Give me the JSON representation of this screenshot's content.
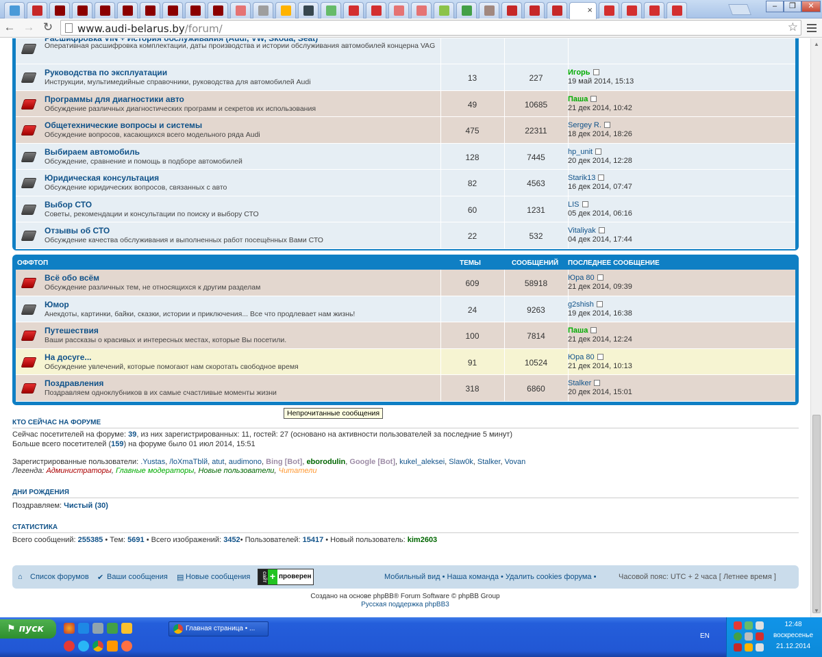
{
  "browser": {
    "url_host": "www.audi-belarus.by",
    "url_path": "/forum/",
    "tabs_count": 30,
    "active_tab_index": 25
  },
  "section1": {
    "rows": [
      {
        "title": "Расшифровка VIN + История обслуживания (Audi, VW, Skoda, Seat)",
        "desc": "Оперативная расшифровка комплектации, даты производства и истории обслуживания автомобилей концерна VAG",
        "topics": "",
        "posts": "",
        "last_user": "",
        "last_date": "",
        "state": "read",
        "user_style": "normal"
      },
      {
        "title": "Руководства по эксплуатации",
        "desc": "Инструкции, мультимедийные справочники, руководства для автомобилей Audi",
        "topics": "13",
        "posts": "227",
        "last_user": "Игорь",
        "last_date": "19 май 2014, 15:13",
        "state": "read",
        "user_style": "mod"
      },
      {
        "title": "Программы для диагностики авто",
        "desc": "Обсуждение различных диагностических программ и секретов их использования",
        "topics": "49",
        "posts": "10685",
        "last_user": "Паша",
        "last_date": "21 дек 2014, 10:42",
        "state": "unread",
        "user_style": "mod"
      },
      {
        "title": "Общетехнические вопросы и системы",
        "desc": "Обсуждение вопросов, касающихся всего модельного ряда Audi",
        "topics": "475",
        "posts": "22311",
        "last_user": "Sergey R.",
        "last_date": "18 дек 2014, 18:26",
        "state": "unread",
        "user_style": "normal"
      },
      {
        "title": "Выбираем автомобиль",
        "desc": "Обсуждение, сравнение и помощь в подборе автомобилей",
        "topics": "128",
        "posts": "7445",
        "last_user": "hp_unit",
        "last_date": "20 дек 2014, 12:28",
        "state": "read",
        "user_style": "normal"
      },
      {
        "title": "Юридическая консультация",
        "desc": "Обсуждение юридических вопросов, связанных с авто",
        "topics": "82",
        "posts": "4563",
        "last_user": "Starik13",
        "last_date": "16 дек 2014, 07:47",
        "state": "read",
        "user_style": "normal"
      },
      {
        "title": "Выбор СТО",
        "desc": "Советы, рекомендации и консультации по поиску и выбору СТО",
        "topics": "60",
        "posts": "1231",
        "last_user": "LIS",
        "last_date": "05 дек 2014, 06:16",
        "state": "read",
        "user_style": "normal"
      },
      {
        "title": "Отзывы об СТО",
        "desc": "Обсуждение качества обслуживания и выполненных работ посещённых Вами СТО",
        "topics": "22",
        "posts": "532",
        "last_user": "Vitaliyak",
        "last_date": "04 дек 2014, 17:44",
        "state": "read",
        "user_style": "normal"
      }
    ]
  },
  "section2": {
    "header": {
      "name": "ОФФТОП",
      "topics": "ТЕМЫ",
      "posts": "СООБЩЕНИЙ",
      "last": "ПОСЛЕДНЕЕ СООБЩЕНИЕ"
    },
    "rows": [
      {
        "title": "Всё обо всём",
        "desc": "Обсуждение различных тем, не относящихся к другим разделам",
        "topics": "609",
        "posts": "58918",
        "last_user": "Юра 80",
        "last_date": "21 дек 2014, 09:39",
        "state": "unread",
        "user_style": "normal"
      },
      {
        "title": "Юмор",
        "desc": "Анекдоты, картинки, байки, сказки, истории и приключения... Все что продлевает нам жизнь!",
        "topics": "24",
        "posts": "9263",
        "last_user": "g2shish",
        "last_date": "19 дек 2014, 16:38",
        "state": "read",
        "user_style": "normal"
      },
      {
        "title": "Путешествия",
        "desc": "Ваши рассказы о красивых и интересных местах, которые Вы посетили.",
        "topics": "100",
        "posts": "7814",
        "last_user": "Паша",
        "last_date": "21 дек 2014, 12:24",
        "state": "unread",
        "user_style": "mod"
      },
      {
        "title": "На досуге...",
        "desc": "Обсуждение увлечений, которые помогают нам скоротать свободное время",
        "topics": "91",
        "posts": "10524",
        "last_user": "Юра 80",
        "last_date": "21 дек 2014, 10:13",
        "state": "unread",
        "user_style": "normal"
      },
      {
        "title": "Поздравления",
        "desc": "Поздравляем одноклубников в их самые счастливые моменты жизни",
        "topics": "318",
        "posts": "6860",
        "last_user": "Stalker",
        "last_date": "20 дек 2014, 15:01",
        "state": "unread",
        "user_style": "normal"
      }
    ]
  },
  "tooltip": "Непрочитанные сообщения",
  "online": {
    "title": "КТО СЕЙЧАС НА ФОРУМЕ",
    "line1_pre": "Сейчас посетителей на форуме: ",
    "line1_count": "39",
    "line1_post": ", из них зарегистрированных: 11, гостей: 27 (основано на активности пользователей за последние 5 минут)",
    "line2_pre": "Больше всего посетителей (",
    "line2_count": "159",
    "line2_post": ") на форуме было 01 июл 2014, 15:51",
    "reg_label": "Зарегистрированные пользователи: ",
    "users": [
      ".Yustas",
      "/loXmaTblй",
      "atut",
      "audimono",
      "Bing [Bot]",
      "eborodulin",
      "Google [Bot]",
      "kukel_aleksei",
      "Slaw0k",
      "Stalker",
      "Vovan"
    ],
    "legend_label": "Легенда: ",
    "legend": [
      "Администраторы",
      "Главные модераторы",
      "Новые пользователи",
      "Читатели"
    ]
  },
  "birthdays": {
    "title": "ДНИ РОЖДЕНИЯ",
    "text": "Поздравляем: ",
    "name": "Чистый (30)"
  },
  "stats": {
    "title": "СТАТИСТИКА",
    "l1": "Всего сообщений: ",
    "v1": "255385",
    "l2": " • Тем: ",
    "v2": "5691",
    "l3": " • Всего изображений: ",
    "v3": "3452",
    "l4": "• Пользователей: ",
    "v4": "15417",
    "l5": " • Новый пользователь: ",
    "v5": "kim2603"
  },
  "navbar": {
    "forums": "Список форумов",
    "your_posts": "Ваши сообщения",
    "new_posts": "Новые сообщения",
    "badge_left": "сайт",
    "badge_plus": "+",
    "badge_text": "проверен",
    "right": "Мобильный вид • Наша команда • Удалить cookies форума • ",
    "timezone": "Часовой пояс: UTC + 2 часа [ Летнее время ]"
  },
  "footer": {
    "line1": "Создано на основе phpBB® Forum Software © phpBB Group",
    "line2": "Русская поддержка phpBB3"
  },
  "taskbar": {
    "start": "пуск",
    "window": "Главная страница • ...",
    "lang": "EN",
    "time": "12:48",
    "day": "воскресенье",
    "date": "21.12.2014"
  }
}
